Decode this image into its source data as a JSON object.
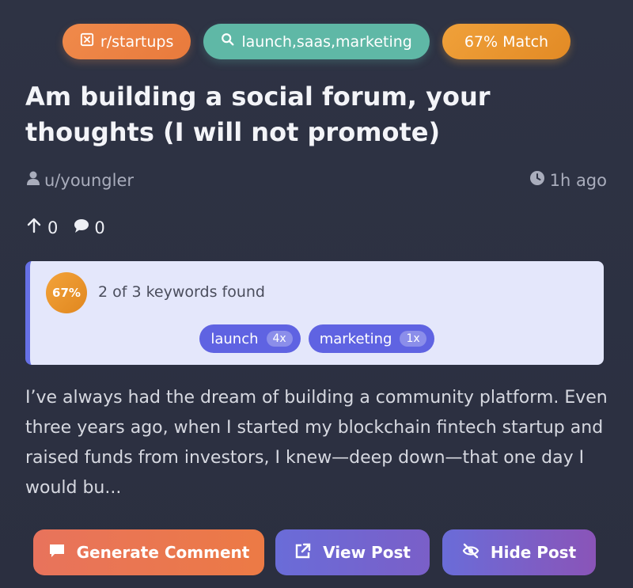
{
  "tags": {
    "subreddit": "r/startups",
    "keywords": "launch,saas,marketing",
    "match": "67% Match"
  },
  "post": {
    "title": "Am building a social forum, your thoughts (I will not promote)",
    "author": "u/youngler",
    "time": "1h ago",
    "upvotes": "0",
    "comments": "0",
    "excerpt": "I’ve always had the dream of building a community platform. Even three years ago, when I started my blockchain fintech startup and raised funds from investors, I knew—deep down—that one day I would bu..."
  },
  "match_box": {
    "percent": "67%",
    "summary": "2 of 3 keywords found",
    "keywords": [
      {
        "label": "launch",
        "count": "4x"
      },
      {
        "label": "marketing",
        "count": "1x"
      }
    ]
  },
  "actions": {
    "generate": "Generate Comment",
    "view": "View Post",
    "hide": "Hide Post"
  },
  "colors": {
    "background": "#2e3344",
    "subreddit_tag": "#f08a4b",
    "keyword_tag": "#5fb8a6",
    "match_tag": "#f0a13a",
    "keyword_chip": "#5f63e2",
    "match_box": "#e4e7fb"
  }
}
